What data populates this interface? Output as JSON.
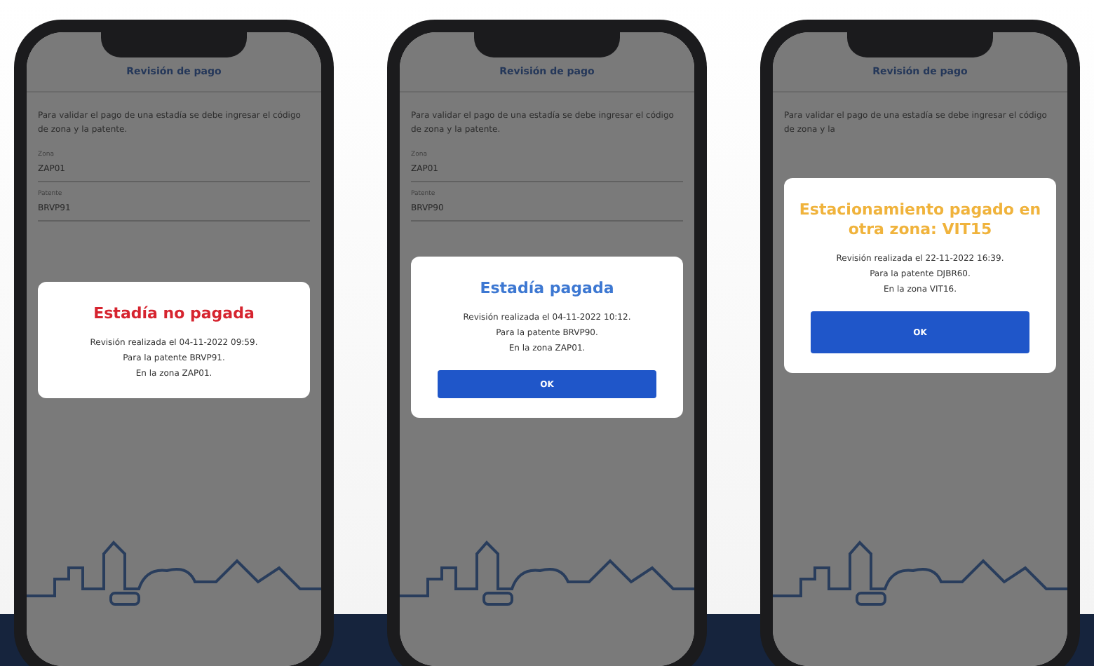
{
  "phones": [
    {
      "header": "Revisión de pago",
      "intro": "Para validar el pago de una estadía se debe ingresar el código de zona y la patente.",
      "fields": [
        {
          "label": "Zona",
          "value": "ZAP01"
        },
        {
          "label": "Patente",
          "value": "BRVP91"
        }
      ],
      "dialog": {
        "kind": "error",
        "title": "Estadía no pagada",
        "lines": [
          "Revisión realizada el 04-11-2022 09:59.",
          "Para la patente BRVP91.",
          "En la zona ZAP01."
        ]
      }
    },
    {
      "header": "Revisión de pago",
      "intro": "Para validar el pago de una estadía se debe ingresar el código de zona y la patente.",
      "fields": [
        {
          "label": "Zona",
          "value": "ZAP01"
        },
        {
          "label": "Patente",
          "value": "BRVP90"
        }
      ],
      "dialog": {
        "kind": "success",
        "title": "Estadía pagada",
        "lines": [
          "Revisión realizada el 04-11-2022 10:12.",
          "Para la patente BRVP90.",
          "En la zona ZAP01."
        ],
        "button": "OK"
      }
    },
    {
      "header": "Revisión de pago",
      "intro": "Para validar el pago de una estadía se debe ingresar el código de zona y la",
      "dialog": {
        "kind": "warning",
        "title": "Estacionamiento pagado en otra zona: VIT15",
        "lines": [
          "Revisión realizada el 22-11-2022 16:39.",
          "Para la patente DJBR60.",
          "En la zona VIT16."
        ],
        "button": "OK"
      }
    }
  ]
}
